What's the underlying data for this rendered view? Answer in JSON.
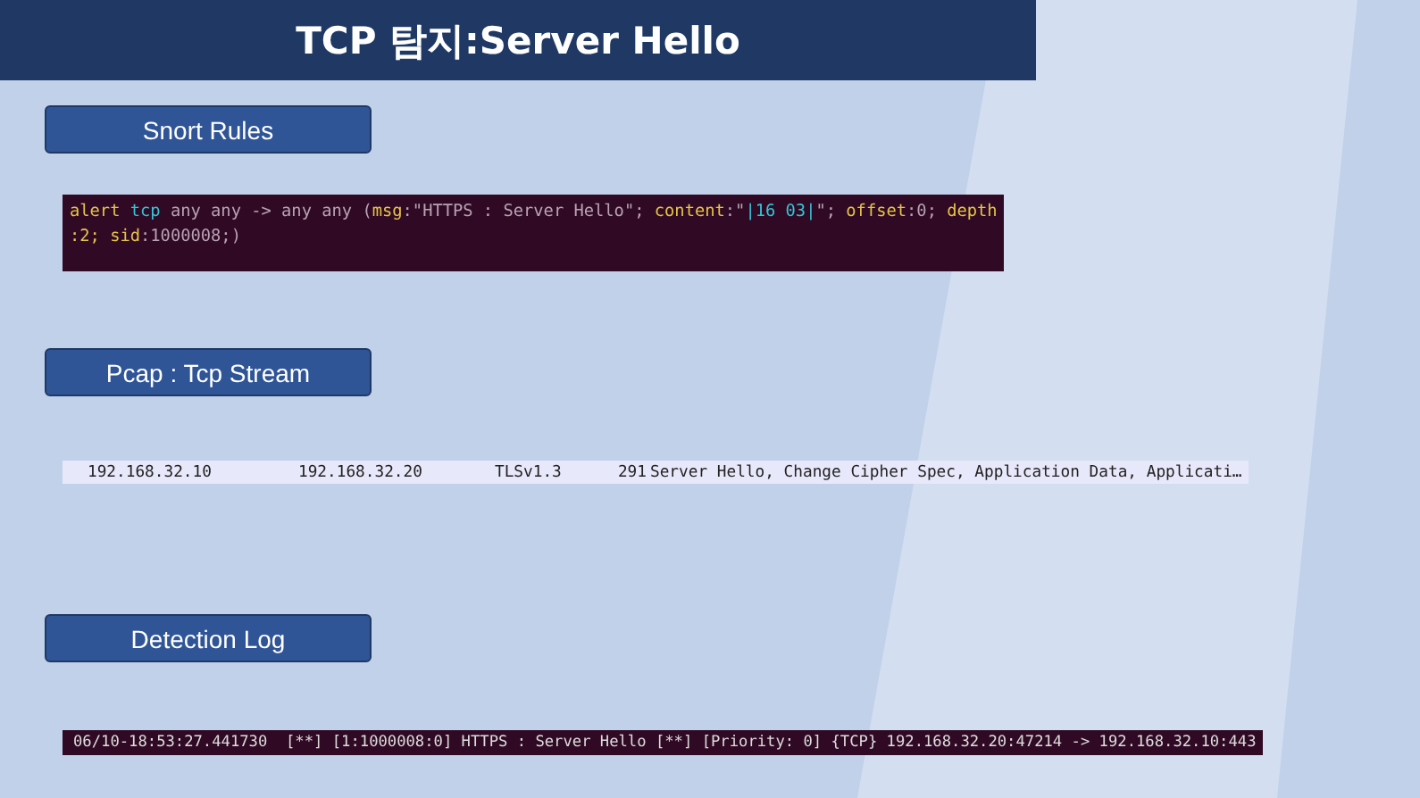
{
  "title": "TCP 탐지:Server Hello",
  "sections": [
    {
      "kind": "rule",
      "label": "Snort Rules",
      "lines": [
        [
          {
            "kind": "key",
            "text": "alert "
          },
          {
            "kind": "proto",
            "text": "tcp"
          },
          {
            "kind": "plain",
            "text": " any any -> any any ("
          },
          {
            "kind": "key",
            "text": "msg"
          },
          {
            "kind": "plain",
            "text": ":\"HTTPS : Server Hello\"; "
          },
          {
            "kind": "key",
            "text": "content"
          },
          {
            "kind": "plain",
            "text": ":\""
          },
          {
            "kind": "proto",
            "text": "|16 03|"
          },
          {
            "kind": "plain",
            "text": "\"; "
          },
          {
            "kind": "key",
            "text": "offset"
          },
          {
            "kind": "plain",
            "text": ":0; "
          },
          {
            "kind": "key",
            "text": "depth"
          }
        ],
        [
          {
            "kind": "key",
            "text": ":2; sid"
          },
          {
            "kind": "plain",
            "text": ":1000008;)"
          }
        ]
      ]
    },
    {
      "kind": "packet",
      "label": "Pcap : Tcp Stream",
      "cells": [
        "192.168.32.10",
        "192.168.32.20",
        "TLSv1.3",
        "291",
        "Server Hello, Change Cipher Spec, Application Data, Applicati…"
      ]
    },
    {
      "kind": "log",
      "label": "Detection Log",
      "lines": [
        "06/10-18:53:27.441730  [**] [1:1000008:0] HTTPS : Server Hello [**] [Priority: 0] {TCP} 192.168.32.20:47214 -> 192.168.32.10:443"
      ]
    }
  ]
}
